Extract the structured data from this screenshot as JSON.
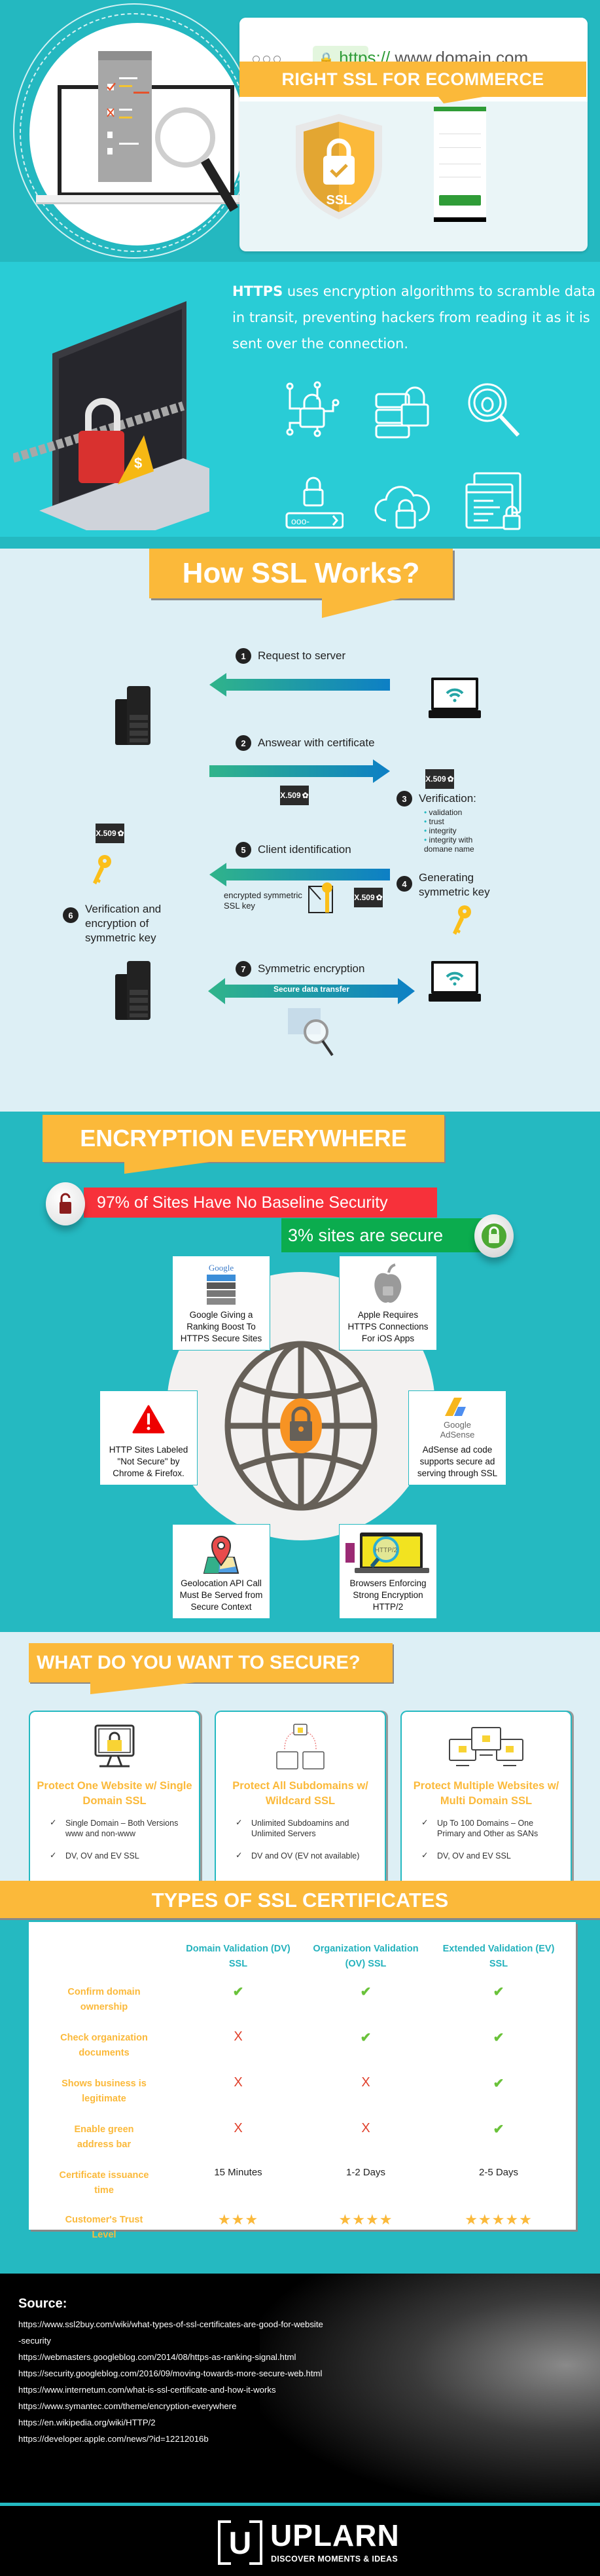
{
  "hero": {
    "browser_dots": [
      "dot",
      "dot",
      "dot"
    ],
    "url_protocol": "https://",
    "url_domain": "www.domain.com",
    "ribbon_title": "RIGHT SSL FOR ECOMMERCE",
    "shield_label": "SSL",
    "colors": {
      "background": "#24b8c0",
      "accent": "#fbb93a",
      "green": "#2f9c37"
    }
  },
  "https_section": {
    "lead_word": "HTTPS",
    "description": " uses encryption algorithms to scramble data in transit, preventing hackers from reading it as it is sent over the connection.",
    "icons": [
      "circuit-lock-icon",
      "server-lock-icon",
      "bug-search-icon",
      "password-lock-icon",
      "cloud-lock-icon",
      "browser-lock-icon"
    ]
  },
  "how_ssl": {
    "title": "How SSL Works?",
    "steps": [
      {
        "num": "1",
        "label": "Request to server"
      },
      {
        "num": "2",
        "label": "Answear with certificate"
      },
      {
        "num": "3",
        "label": "Verification:"
      },
      {
        "num": "4",
        "label": "Generating symmetric key"
      },
      {
        "num": "5",
        "label": "Client identification"
      },
      {
        "num": "6",
        "label": "Verification and encryption of symmetric key"
      },
      {
        "num": "7",
        "label": "Symmetric encryption"
      }
    ],
    "verification_items": [
      "validation",
      "trust",
      "integrity",
      "integrity with domane name"
    ],
    "certificate_label": "X.509",
    "encrypted_key_label": "encrypted symmetric SSL key",
    "secure_transfer_label": "Secure data transfer"
  },
  "encryption": {
    "title": "ENCRYPTION EVERYWHERE",
    "stat_insecure": "97% of Sites Have No Baseline Security",
    "stat_secure": "3% sites are secure",
    "features": [
      {
        "icon": "google-ranking-icon",
        "brand": "Google",
        "text": "Google Giving a Ranking Boost To HTTPS Secure Sites"
      },
      {
        "icon": "apple-lock-icon",
        "text": "Apple Requires HTTPS Connections For iOS Apps"
      },
      {
        "icon": "warning-icon",
        "text": "HTTP Sites Labeled \"Not Secure\" by Chrome & Firefox."
      },
      {
        "icon": "adsense-icon",
        "brand": "Google AdSense",
        "text": "AdSense ad code supports secure ad serving through SSL"
      },
      {
        "icon": "map-pin-icon",
        "text": "Geolocation API Call Must Be Served from Secure Context"
      },
      {
        "icon": "http2-laptop-icon",
        "brand": "HTTP/2",
        "text": "Browsers Enforcing Strong Encryption HTTP/2"
      }
    ]
  },
  "secure": {
    "title": "WHAT DO YOU WANT TO SECURE?",
    "cards": [
      {
        "title": "Protect One Website w/ Single Domain SSL",
        "icon": "single-monitor-lock-icon",
        "items": [
          "Single Domain – Both Versions www and non-www",
          "DV, OV and EV SSL"
        ]
      },
      {
        "title": "Protect All Subdomains w/ Wildcard SSL",
        "icon": "subdomain-lock-icon",
        "items": [
          "Unlimited Subdoamins and Unlimited Servers",
          "DV and OV (EV not available)"
        ]
      },
      {
        "title": "Protect Multiple Websites w/ Multi Domain SSL",
        "icon": "multi-monitor-lock-icon",
        "items": [
          "Up To 100 Domains – One Primary and Other as SANs",
          "DV, OV and EV SSL"
        ]
      }
    ]
  },
  "types": {
    "title": "TYPES OF SSL CERTIFICATES",
    "columns": [
      "Domain Validation (DV) SSL",
      "Organization Validation (OV) SSL",
      "Extended Validation (EV) SSL"
    ],
    "rows": [
      {
        "label": "Confirm domain ownership",
        "values": [
          "yes",
          "yes",
          "yes"
        ]
      },
      {
        "label": "Check organization documents",
        "values": [
          "no",
          "yes",
          "yes"
        ]
      },
      {
        "label": "Shows business is legitimate",
        "values": [
          "no",
          "no",
          "yes"
        ]
      },
      {
        "label": "Enable green address bar",
        "values": [
          "no",
          "no",
          "yes"
        ]
      },
      {
        "label": "Certificate issuance time",
        "values": [
          "15 Minutes",
          "1-2 Days",
          "2-5 Days"
        ]
      },
      {
        "label": "Customer's Trust Level",
        "stars": [
          3,
          4,
          5
        ]
      }
    ],
    "check_glyph": "✔",
    "cross_glyph": "X",
    "star_glyph": "★"
  },
  "source": {
    "title": "Source:",
    "links": [
      "https://www.ssl2buy.com/wiki/what-types-of-ssl-certificates-are-good-for-website-security",
      "https://webmasters.googleblog.com/2014/08/https-as-ranking-signal.html",
      "https://security.googleblog.com/2016/09/moving-towards-more-secure-web.html",
      "https://www.internetum.com/what-is-ssl-certificate-and-how-it-works",
      "https://www.symantec.com/theme/encryption-everywhere",
      "https://en.wikipedia.org/wiki/HTTP/2",
      "https://developer.apple.com/news/?id=12212016b"
    ]
  },
  "footer": {
    "logo_letter": "U",
    "brand": "UPLARN",
    "tagline": "DISCOVER MOMENTS & IDEAS"
  }
}
